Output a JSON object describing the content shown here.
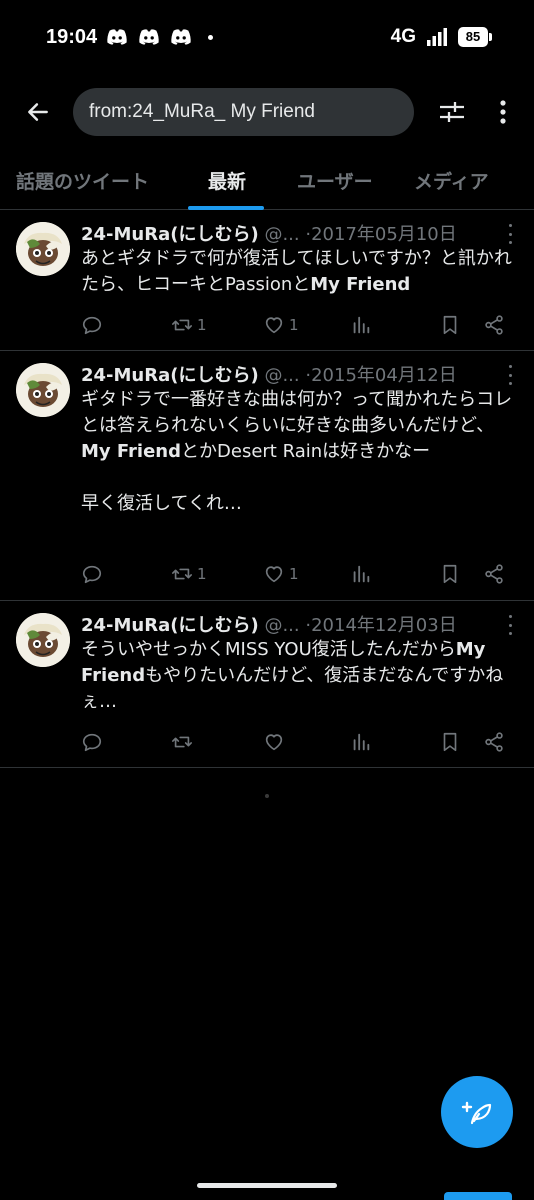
{
  "status_bar": {
    "time": "19:04",
    "network": "4G",
    "battery": "85",
    "notification_icons": [
      "discord-icon",
      "discord-icon",
      "discord-icon"
    ]
  },
  "search": {
    "query": "from:24_MuRa_ My Friend"
  },
  "tabs": [
    {
      "label": "話題のツイート",
      "active": false
    },
    {
      "label": "最新",
      "active": true
    },
    {
      "label": "ユーザー",
      "active": false
    },
    {
      "label": "メディア",
      "active": false
    }
  ],
  "tweets": [
    {
      "name": "24-MuRa(にしむら)",
      "handle": "@...",
      "sep": "·",
      "date": "2017年05月10日",
      "text_parts": [
        "あとギタドラで何が復活してほしいですか？と訊かれたら、ヒコーキとPassionと",
        "My Friend",
        ""
      ],
      "replies": "",
      "retweets": "1",
      "likes": "1"
    },
    {
      "name": "24-MuRa(にしむら)",
      "handle": "@...",
      "sep": "·",
      "date": "2015年04月12日",
      "text_parts": [
        "ギタドラで一番好きな曲は何か？って聞かれたらコレとは答えられないくらいに好きな曲多いんだけど、",
        "My Friend",
        "とかDesert Rainは好きかなー\n\n早く復活してくれ…"
      ],
      "replies": "",
      "retweets": "1",
      "likes": "1"
    },
    {
      "name": "24-MuRa(にしむら)",
      "handle": "@...",
      "sep": "·",
      "date": "2014年12月03日",
      "text_parts": [
        "そういやせっかくMISS YOU復活したんだから",
        "My Friend",
        "もやりたいんだけど、復活まだなんですかねぇ…"
      ],
      "replies": "",
      "retweets": "",
      "likes": ""
    }
  ],
  "colors": {
    "accent": "#1d9bf0",
    "background": "#000000",
    "muted": "#71767b"
  }
}
